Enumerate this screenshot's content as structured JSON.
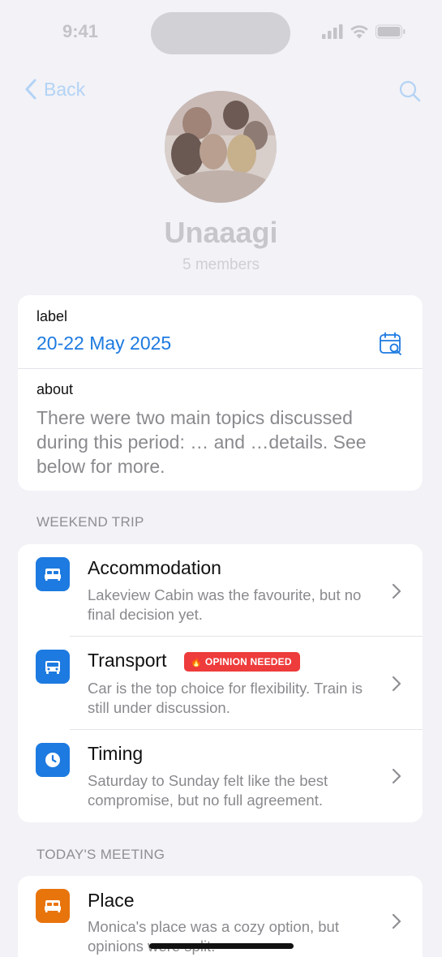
{
  "status_bar": {
    "time": "9:41"
  },
  "nav": {
    "back_label": "Back"
  },
  "group": {
    "name": "Unaaagi",
    "members": "5 members"
  },
  "info": {
    "label_title": "label",
    "date": "20-22 May 2025",
    "about_title": "about",
    "about_text": "There were two main topics discussed during this period: … and …details. See below for more."
  },
  "sections": [
    {
      "header": "WEEKEND TRIP",
      "items": [
        {
          "title": "Accommodation",
          "desc": "Lakeview Cabin was the favourite, but no final decision yet.",
          "icon": "bed-icon",
          "color": "#1d7ae0"
        },
        {
          "title": "Transport",
          "badge": "OPINION NEEDED",
          "badge_icon": "🔥",
          "desc": "Car is the top choice for flexibility. Train is still under discussion.",
          "icon": "car-icon",
          "color": "#1d7ae0"
        },
        {
          "title": "Timing",
          "desc": "Saturday to Sunday felt like the best compromise, but no full agreement.",
          "icon": "clock-icon",
          "color": "#1d7ae0"
        }
      ]
    },
    {
      "header": "TODAY'S MEETING",
      "items": [
        {
          "title": "Place",
          "desc": "Monica's place was a cozy option, but opinions were split.",
          "icon": "bed-icon",
          "color": "#e8740c"
        }
      ]
    }
  ]
}
